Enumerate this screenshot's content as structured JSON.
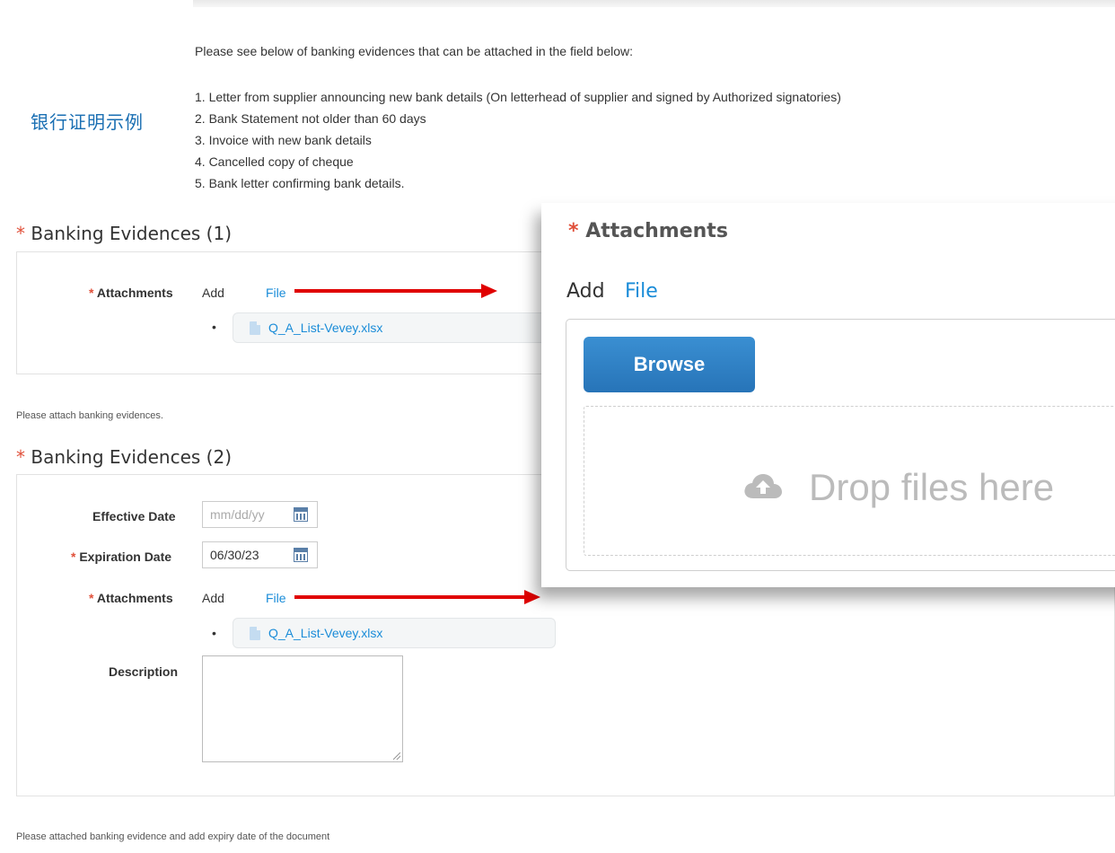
{
  "intro": "Please see below of banking evidences that can be attached in the field below:",
  "cn_title": "银行证明示例",
  "evidence_list": [
    "1. Letter from supplier announcing new bank details (On letterhead of supplier and signed by Authorized signatories)",
    "2. Bank Statement not older than 60 days",
    "3. Invoice with new bank details",
    "4. Cancelled copy of cheque",
    "5. Bank letter confirming bank details."
  ],
  "required_mark": "*",
  "section1": {
    "title": "Banking Evidences (1)",
    "attachments_label": "Attachments",
    "add_label": "Add",
    "file_link": "File",
    "bullet": "•",
    "file_name": "Q_A_List-Vevey.xlsx",
    "help": "Please attach banking evidences."
  },
  "section2": {
    "title": "Banking Evidences (2)",
    "effective_label": "Effective Date",
    "effective_placeholder": "mm/dd/yy",
    "expiration_label": "Expiration Date",
    "expiration_value": "06/30/23",
    "attachments_label": "Attachments",
    "add_label": "Add",
    "file_link": "File",
    "bullet": "•",
    "file_name": "Q_A_List-Vevey.xlsx",
    "description_label": "Description",
    "help": "Please attached banking evidence and add expiry date of the document"
  },
  "zoom": {
    "title": "Attachments",
    "add_label": "Add",
    "file_link": "File",
    "browse": "Browse",
    "drop_text": "Drop files here"
  },
  "colors": {
    "link": "#1a8cd8",
    "required": "#e0503a",
    "arrow": "#e00000",
    "browse": "#2f80c4"
  }
}
